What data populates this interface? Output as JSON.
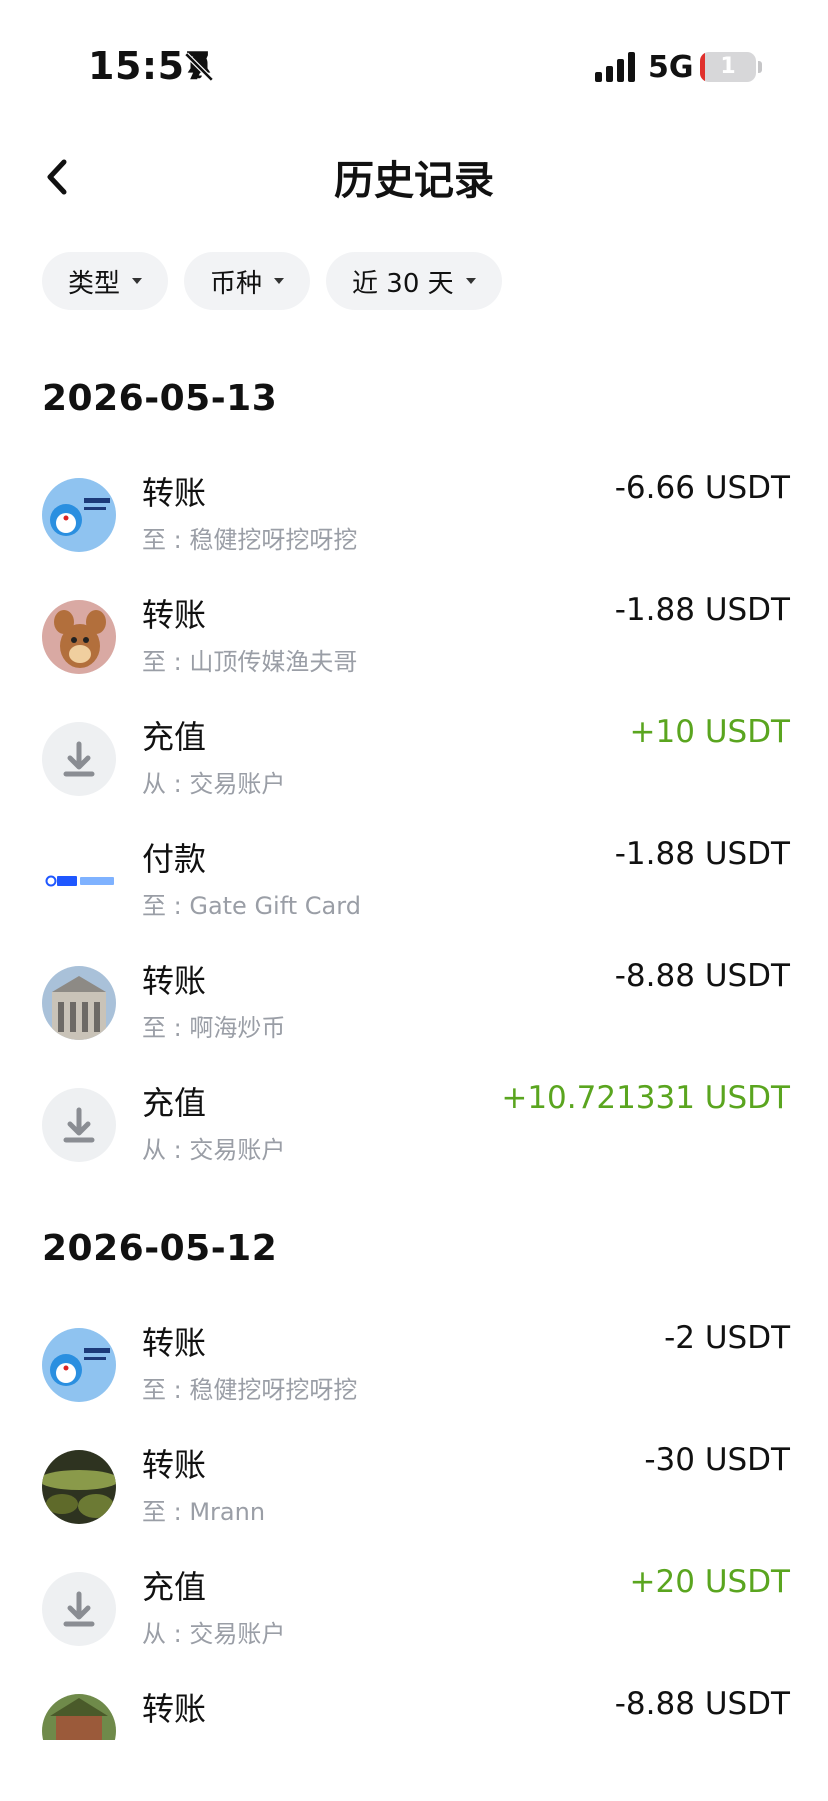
{
  "status_bar": {
    "time": "15:57",
    "network": "5G",
    "battery": "1"
  },
  "header": {
    "title": "历史记录"
  },
  "filters": [
    {
      "label": "类型"
    },
    {
      "label": "币种"
    },
    {
      "label": "近 30 天"
    }
  ],
  "sections": [
    {
      "date": "2026-05-13",
      "items": [
        {
          "title": "转账",
          "sub": "至 : 稳健挖呀挖呀挖",
          "amount": "-6.66 USDT",
          "positive": false,
          "avatar": "doraemon-avatar"
        },
        {
          "title": "转账",
          "sub": "至 : 山顶传媒渔夫哥",
          "amount": "-1.88 USDT",
          "positive": false,
          "avatar": "jerry-avatar"
        },
        {
          "title": "充值",
          "sub": "从 : 交易账户",
          "amount": "+10 USDT",
          "positive": true,
          "avatar": "download-icon"
        },
        {
          "title": "付款",
          "sub": "至 : Gate Gift Card",
          "amount": "-1.88 USDT",
          "positive": false,
          "avatar": "gate-giftcard-logo"
        },
        {
          "title": "转账",
          "sub": "至 : 啊海炒币",
          "amount": "-8.88 USDT",
          "positive": false,
          "avatar": "building-avatar"
        },
        {
          "title": "充值",
          "sub": "从 : 交易账户",
          "amount": "+10.721331 USDT",
          "positive": true,
          "avatar": "download-icon"
        }
      ]
    },
    {
      "date": "2026-05-12",
      "items": [
        {
          "title": "转账",
          "sub": "至 : 稳健挖呀挖呀挖",
          "amount": "-2 USDT",
          "positive": false,
          "avatar": "doraemon-avatar"
        },
        {
          "title": "转账",
          "sub": "至 : Mrann",
          "amount": "-30 USDT",
          "positive": false,
          "avatar": "landscape-avatar"
        },
        {
          "title": "充值",
          "sub": "从 : 交易账户",
          "amount": "+20 USDT",
          "positive": true,
          "avatar": "download-icon"
        },
        {
          "title": "转账",
          "sub": "",
          "amount": "-8.88 USDT",
          "positive": false,
          "avatar": "temple-avatar"
        }
      ]
    }
  ],
  "colors": {
    "positive": "#5aa51f",
    "negative": "#111111",
    "secondary": "#9a9ea6",
    "chip_bg": "#f2f3f5"
  }
}
